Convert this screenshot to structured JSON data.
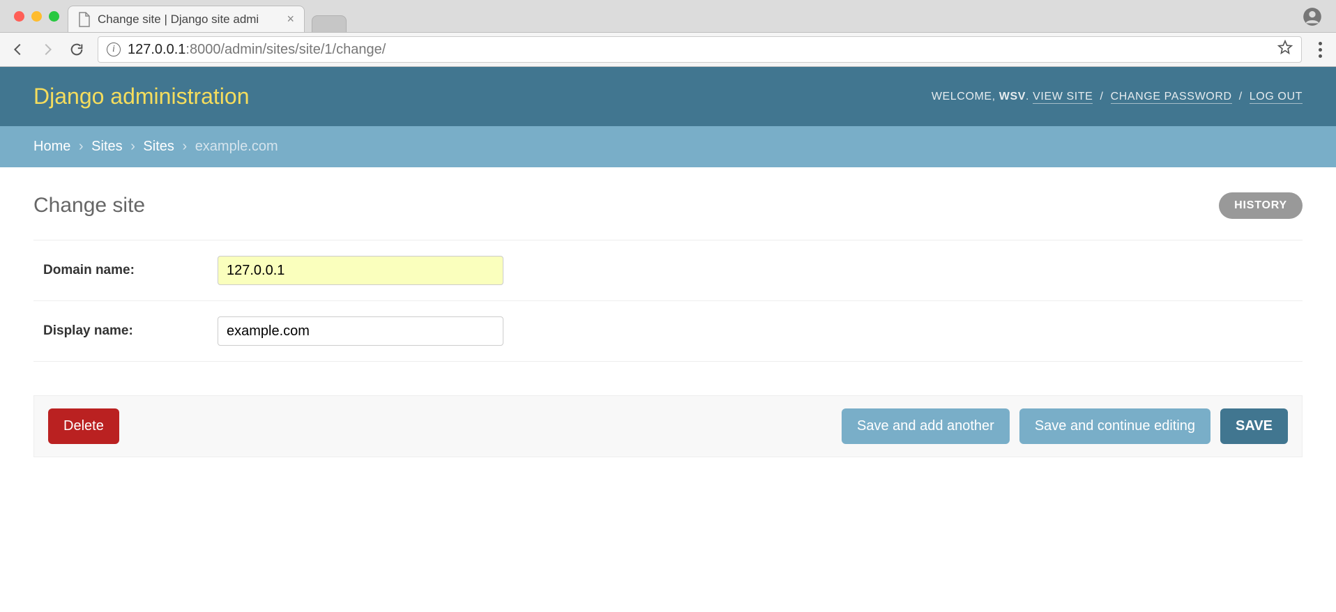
{
  "browser": {
    "tab_title": "Change site | Django site admi",
    "url_host": "127.0.0.1",
    "url_port_path": ":8000/admin/sites/site/1/change/"
  },
  "header": {
    "branding": "Django administration",
    "welcome_prefix": "WELCOME, ",
    "username": "WSV",
    "welcome_suffix": ". ",
    "view_site": "VIEW SITE",
    "change_password": "CHANGE PASSWORD",
    "log_out": "LOG OUT"
  },
  "breadcrumbs": {
    "home": "Home",
    "app": "Sites",
    "model": "Sites",
    "current": "example.com"
  },
  "content": {
    "title": "Change site",
    "history": "HISTORY"
  },
  "form": {
    "domain_label": "Domain name:",
    "domain_value": "127.0.0.1",
    "display_label": "Display name:",
    "display_value": "example.com"
  },
  "buttons": {
    "delete": "Delete",
    "save_add": "Save and add another",
    "save_continue": "Save and continue editing",
    "save": "SAVE"
  }
}
